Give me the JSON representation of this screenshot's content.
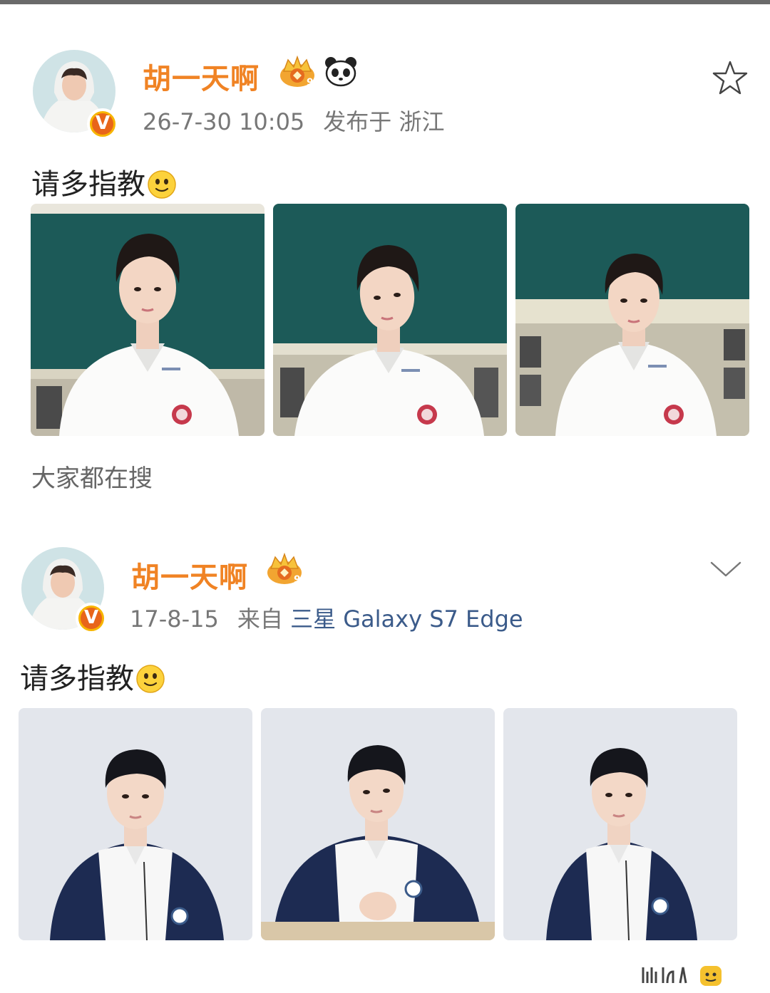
{
  "posts": [
    {
      "user_name": "胡一天啊",
      "verified_mark": "V",
      "timestamp": "26-7-30 10:05",
      "location_text": "发布于 浙江",
      "text": "请多指教",
      "badges": [
        "crown-level-9-icon",
        "panda-icon"
      ],
      "action_icon": "star-icon",
      "photos": [
        {
          "scene": "classroom-green-board",
          "shirt": "white-polo"
        },
        {
          "scene": "classroom-green-board",
          "shirt": "white-polo"
        },
        {
          "scene": "classroom-green-board",
          "shirt": "white-polo"
        }
      ],
      "footer_label": "大家都在搜"
    },
    {
      "user_name": "胡一天啊",
      "verified_mark": "V",
      "timestamp": "17-8-15",
      "source_prefix": "来自",
      "device": "三星 Galaxy S7 Edge",
      "text": "请多指教",
      "badges": [
        "crown-level-9-icon"
      ],
      "action_icon": "chevron-down-icon",
      "photos": [
        {
          "scene": "grey-studio",
          "shirt": "navy-white-jacket"
        },
        {
          "scene": "grey-studio",
          "shirt": "navy-white-jacket"
        },
        {
          "scene": "grey-studio",
          "shirt": "navy-white-jacket"
        }
      ]
    }
  ],
  "colors": {
    "username": "#f08324",
    "device_link": "#3b5b8a",
    "meta_text": "#777777",
    "verified_badge": "#f7b500"
  }
}
